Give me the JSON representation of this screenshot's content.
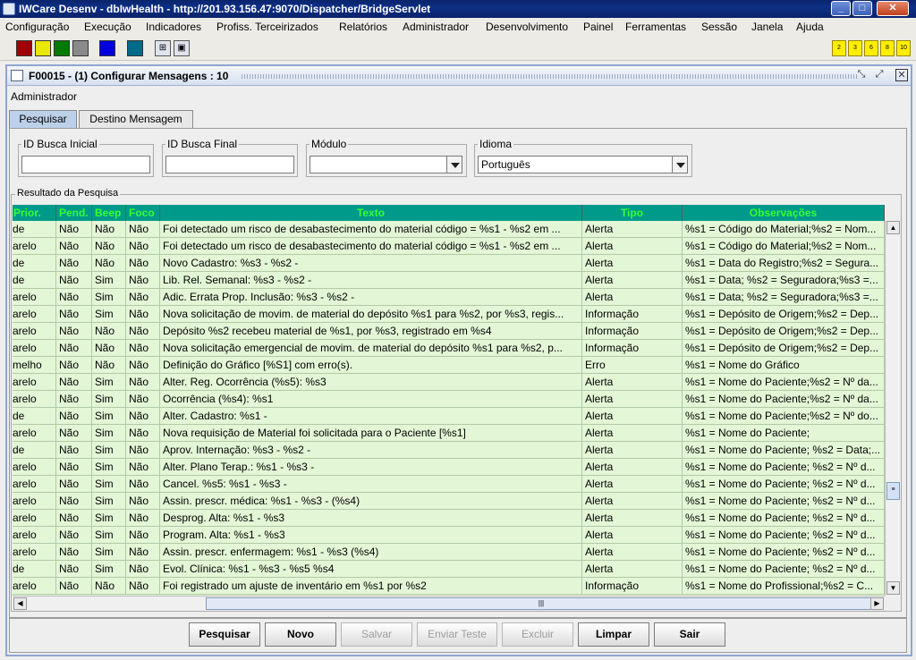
{
  "window": {
    "title": "IWCare Desenv - dbIwHealth - http://201.93.156.47:9070/Dispatcher/BridgeServlet",
    "minimize": "_",
    "maximize": "□",
    "close": "✕"
  },
  "menu": [
    "Configuração",
    "Execução",
    "Indicadores",
    "Profiss. Terceirizados",
    "Relatórios",
    "Administrador",
    "Desenvolvimento",
    "Painel",
    "Ferramentas",
    "Sessão",
    "Janela",
    "Ajuda"
  ],
  "toolbar": {
    "swatches": [
      "#a00000",
      "#e8e800",
      "#007a00",
      "#8a8a8a",
      "#0000dd",
      "#006a8a"
    ],
    "numbers": [
      "2",
      "3",
      "6",
      "8",
      "10"
    ]
  },
  "frame": {
    "title": "F00015 - (1) Configurar Mensagens : 10",
    "user_label": "Administrador"
  },
  "tabs": [
    {
      "label": "Pesquisar",
      "active": true
    },
    {
      "label": "Destino Mensagem",
      "active": false
    }
  ],
  "filters": {
    "id_inicial": {
      "label": "ID Busca Inicial",
      "value": ""
    },
    "id_final": {
      "label": "ID Busca Final",
      "value": ""
    },
    "modulo": {
      "label": "Módulo",
      "value": ""
    },
    "idioma": {
      "label": "Idioma",
      "value": "Português"
    }
  },
  "results": {
    "label": "Resultado da Pesquisa",
    "columns": [
      "Prior.",
      "Pend.",
      "Beep",
      "Foco",
      "Texto",
      "Tipo",
      "Observações"
    ],
    "rows": [
      [
        "de",
        "Não",
        "Não",
        "Não",
        "Foi detectado um risco de desabastecimento do material  código = %s1 - %s2 em ...",
        "Alerta",
        "%s1 = Código do Material;%s2 = Nom..."
      ],
      [
        "arelo",
        "Não",
        "Não",
        "Não",
        "Foi detectado um risco de desabastecimento do material  código = %s1 - %s2 em ...",
        "Alerta",
        "%s1 = Código do Material;%s2 = Nom..."
      ],
      [
        "de",
        "Não",
        "Não",
        "Não",
        "Novo Cadastro: %s3 - %s2 -",
        "Alerta",
        "%s1 = Data do Registro;%s2 = Segura..."
      ],
      [
        "de",
        "Não",
        "Sim",
        "Não",
        "Lib. Rel. Semanal: %s3 - %s2 -",
        "Alerta",
        "%s1 = Data; %s2 = Seguradora;%s3 =..."
      ],
      [
        "arelo",
        "Não",
        "Sim",
        "Não",
        "Adic. Errata Prop. Inclusão: %s3 - %s2 -",
        "Alerta",
        "%s1 = Data; %s2 = Seguradora;%s3 =..."
      ],
      [
        "arelo",
        "Não",
        "Sim",
        "Não",
        "Nova solicitação de movim. de material do depósito %s1 para %s2, por %s3, regis...",
        "Informação",
        "%s1 = Depósito de Origem;%s2 = Dep..."
      ],
      [
        "arelo",
        "Não",
        "Não",
        "Não",
        "Depósito %s2 recebeu material de %s1, por %s3, registrado em %s4",
        "Informação",
        "%s1 = Depósito de Origem;%s2 = Dep..."
      ],
      [
        "arelo",
        "Não",
        "Não",
        "Não",
        "Nova solicitação emergencial de movim. de material do depósito %s1 para %s2, p...",
        "Informação",
        "%s1 = Depósito de Origem;%s2 = Dep..."
      ],
      [
        "melho",
        "Não",
        "Não",
        "Não",
        "Definição do Gráfico [%S1] com erro(s).",
        "Erro",
        "%s1 = Nome do Gráfico"
      ],
      [
        "arelo",
        "Não",
        "Sim",
        "Não",
        "Alter. Reg. Ocorrência (%s5): %s3",
        "Alerta",
        "%s1 = Nome do Paciente;%s2 = Nº da..."
      ],
      [
        "arelo",
        "Não",
        "Sim",
        "Não",
        "Ocorrência (%s4): %s1",
        "Alerta",
        "%s1 = Nome do Paciente;%s2 = Nº da..."
      ],
      [
        "de",
        "Não",
        "Sim",
        "Não",
        "Alter. Cadastro: %s1 -",
        "Alerta",
        "%s1 = Nome do Paciente;%s2 = Nº do..."
      ],
      [
        "arelo",
        "Não",
        "Sim",
        "Não",
        "Nova requisição de Material foi solicitada para o Paciente [%s1]",
        "Alerta",
        "%s1 = Nome do Paciente;"
      ],
      [
        "de",
        "Não",
        "Sim",
        "Não",
        "Aprov. Internação: %s3 - %s2 -",
        "Alerta",
        "%s1 = Nome do Paciente; %s2 = Data;..."
      ],
      [
        "arelo",
        "Não",
        "Sim",
        "Não",
        "Alter. Plano Terap.: %s1 - %s3 -",
        "Alerta",
        "%s1 = Nome do Paciente; %s2 = Nº d..."
      ],
      [
        "arelo",
        "Não",
        "Sim",
        "Não",
        "Cancel. %s5: %s1 - %s3 -",
        "Alerta",
        "%s1 = Nome do Paciente; %s2 = Nº d..."
      ],
      [
        "arelo",
        "Não",
        "Sim",
        "Não",
        "Assin. prescr. médica: %s1 - %s3 - (%s4)",
        "Alerta",
        "%s1 = Nome do Paciente; %s2 = Nº d..."
      ],
      [
        "arelo",
        "Não",
        "Sim",
        "Não",
        "Desprog. Alta: %s1 - %s3",
        "Alerta",
        "%s1 = Nome do Paciente; %s2 = Nº d..."
      ],
      [
        "arelo",
        "Não",
        "Sim",
        "Não",
        "Program. Alta: %s1 - %s3",
        "Alerta",
        "%s1 = Nome do Paciente; %s2 = Nº d..."
      ],
      [
        "arelo",
        "Não",
        "Sim",
        "Não",
        "Assin. prescr. enfermagem: %s1 - %s3 (%s4)",
        "Alerta",
        "%s1 = Nome do Paciente; %s2 = Nº d..."
      ],
      [
        "de",
        "Não",
        "Sim",
        "Não",
        "Evol. Clínica: %s1 - %s3 - %s5 %s4",
        "Alerta",
        "%s1 = Nome do Paciente; %s2 = Nº d..."
      ],
      [
        "arelo",
        "Não",
        "Não",
        "Não",
        "Foi registrado um ajuste de inventário em %s1 por %s2",
        "Informação",
        "%s1 = Nome do Profissional;%s2 = C..."
      ]
    ]
  },
  "buttons": [
    {
      "label": "Pesquisar",
      "enabled": true
    },
    {
      "label": "Novo",
      "enabled": true
    },
    {
      "label": "Salvar",
      "enabled": false
    },
    {
      "label": "Enviar Teste",
      "enabled": false
    },
    {
      "label": "Excluir",
      "enabled": false
    },
    {
      "label": "Limpar",
      "enabled": true
    },
    {
      "label": "Sair",
      "enabled": true
    }
  ]
}
